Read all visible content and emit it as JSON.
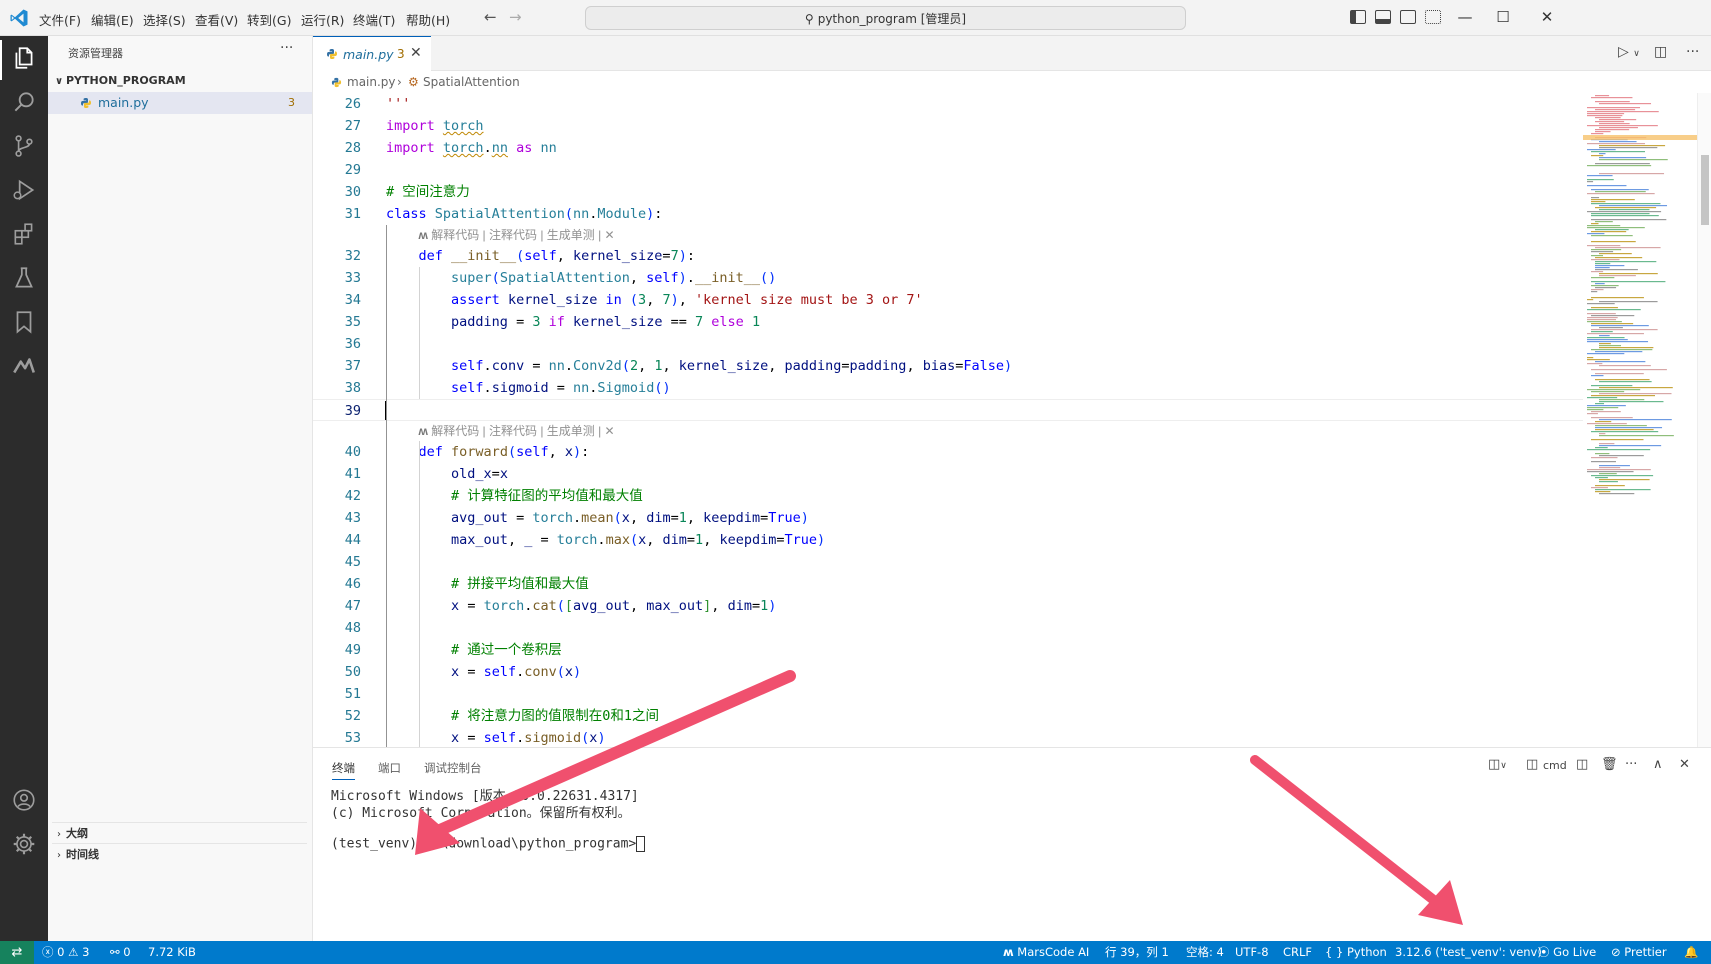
{
  "titlebar": {
    "menus": [
      "文件(F)",
      "编辑(E)",
      "选择(S)",
      "查看(V)",
      "转到(G)",
      "运行(R)",
      "终端(T)",
      "帮助(H)"
    ],
    "search": "python_program [管理员]"
  },
  "explorer": {
    "title": "资源管理器",
    "folder": "PYTHON_PROGRAM",
    "file": {
      "name": "main.py",
      "problems": "3"
    },
    "sections": [
      "大纲",
      "时间线"
    ]
  },
  "editor": {
    "tab": {
      "name": "main.py",
      "problems": "3"
    },
    "breadcrumb": {
      "file": "main.py",
      "symbol": "SpatialAttention"
    },
    "codelens": "解释代码 | 注释代码 | 生成单测 | ✕",
    "lines": [
      {
        "n": "26",
        "t": "'''"
      },
      {
        "n": "27",
        "t": "import torch"
      },
      {
        "n": "28",
        "t": "import torch.nn as nn"
      },
      {
        "n": "29",
        "t": ""
      },
      {
        "n": "30",
        "t": "# 空间注意力"
      },
      {
        "n": "31",
        "t": "class SpatialAttention(nn.Module):"
      },
      {
        "n": "32",
        "t": "    def __init__(self, kernel_size=7):"
      },
      {
        "n": "33",
        "t": "        super(SpatialAttention, self).__init__()"
      },
      {
        "n": "34",
        "t": "        assert kernel_size in (3, 7), 'kernel size must be 3 or 7'"
      },
      {
        "n": "35",
        "t": "        padding = 3 if kernel_size == 7 else 1"
      },
      {
        "n": "36",
        "t": ""
      },
      {
        "n": "37",
        "t": "        self.conv = nn.Conv2d(2, 1, kernel_size, padding=padding, bias=False)"
      },
      {
        "n": "38",
        "t": "        self.sigmoid = nn.Sigmoid()"
      },
      {
        "n": "39",
        "t": ""
      },
      {
        "n": "40",
        "t": "    def forward(self, x):"
      },
      {
        "n": "41",
        "t": "        old_x=x"
      },
      {
        "n": "42",
        "t": "        # 计算特征图的平均值和最大值"
      },
      {
        "n": "43",
        "t": "        avg_out = torch.mean(x, dim=1, keepdim=True)"
      },
      {
        "n": "44",
        "t": "        max_out, _ = torch.max(x, dim=1, keepdim=True)"
      },
      {
        "n": "45",
        "t": ""
      },
      {
        "n": "46",
        "t": "        # 拼接平均值和最大值"
      },
      {
        "n": "47",
        "t": "        x = torch.cat([avg_out, max_out], dim=1)"
      },
      {
        "n": "48",
        "t": ""
      },
      {
        "n": "49",
        "t": "        # 通过一个卷积层"
      },
      {
        "n": "50",
        "t": "        x = self.conv(x)"
      },
      {
        "n": "51",
        "t": ""
      },
      {
        "n": "52",
        "t": "        # 将注意力图的值限制在0和1之间"
      },
      {
        "n": "53",
        "t": "        x = self.sigmoid(x)"
      }
    ]
  },
  "panel": {
    "tabs": [
      "终端",
      "端口",
      "调试控制台"
    ],
    "shell": "cmd",
    "terminal": [
      "Microsoft Windows [版本 10.0.22631.4317]",
      "(c) Microsoft Corporation。保留所有权利。",
      "",
      "(test_venv) C:\\download\\python_program>"
    ]
  },
  "statusbar": {
    "errors": "0",
    "warnings": "3",
    "ports": "0",
    "size": "7.72 KiB",
    "marscode": "MarsCode AI",
    "position": "行 39，列 1",
    "spaces": "空格: 4",
    "encoding": "UTF-8",
    "eol": "CRLF",
    "language": "Python",
    "interpreter": "3.12.6 ('test_venv': venv)",
    "golive": "Go Live",
    "prettier": "Prettier"
  },
  "colors": {
    "accent": "#005fb8",
    "statusbar": "#007acc",
    "activitybar": "#2c2c2c",
    "arrow": "#f0506e"
  }
}
